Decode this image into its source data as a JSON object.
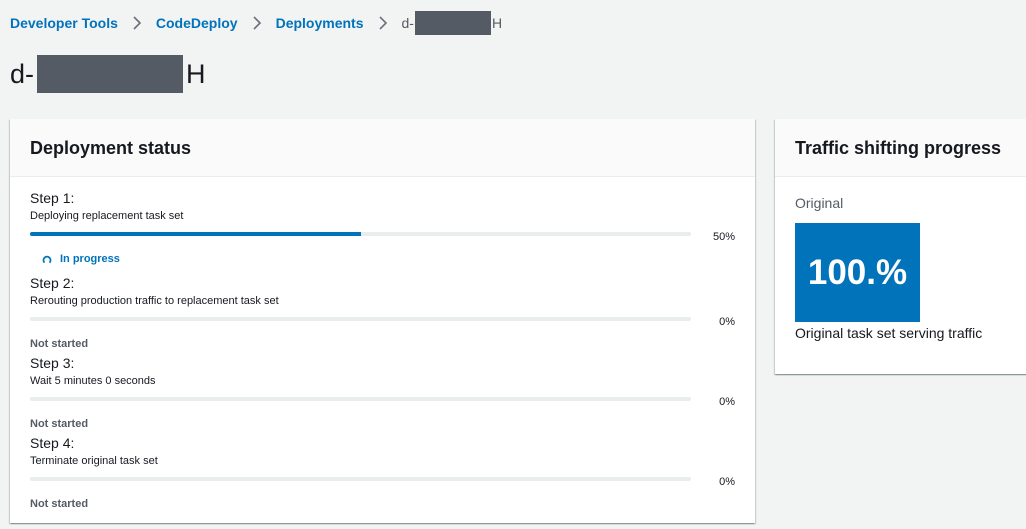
{
  "breadcrumb": {
    "items": [
      "Developer Tools",
      "CodeDeploy",
      "Deployments"
    ],
    "current_prefix": "d-",
    "current_suffix": "H"
  },
  "page": {
    "title_prefix": "d-",
    "title_suffix": "H"
  },
  "deployment_status": {
    "title": "Deployment status",
    "steps": [
      {
        "title": "Step 1:",
        "description": "Deploying replacement task set",
        "progress": 50,
        "progress_label": "50%",
        "status": "In progress"
      },
      {
        "title": "Step 2:",
        "description": "Rerouting production traffic to replacement task set",
        "progress": 0,
        "progress_label": "0%",
        "status": "Not started"
      },
      {
        "title": "Step 3:",
        "description": "Wait 5 minutes 0 seconds",
        "progress": 0,
        "progress_label": "0%",
        "status": "Not started"
      },
      {
        "title": "Step 4:",
        "description": "Terminate original task set",
        "progress": 0,
        "progress_label": "0%",
        "status": "Not started"
      }
    ]
  },
  "traffic": {
    "title": "Traffic shifting progress",
    "original_label": "Original",
    "percent": "100.%",
    "caption": "Original task set serving traffic"
  },
  "colors": {
    "accent": "#0073bb",
    "background": "#f2f3f3",
    "redaction": "#545b64"
  },
  "icons": {
    "breadcrumb_separator": "chevron-right-icon",
    "in_progress": "spinner-icon"
  }
}
